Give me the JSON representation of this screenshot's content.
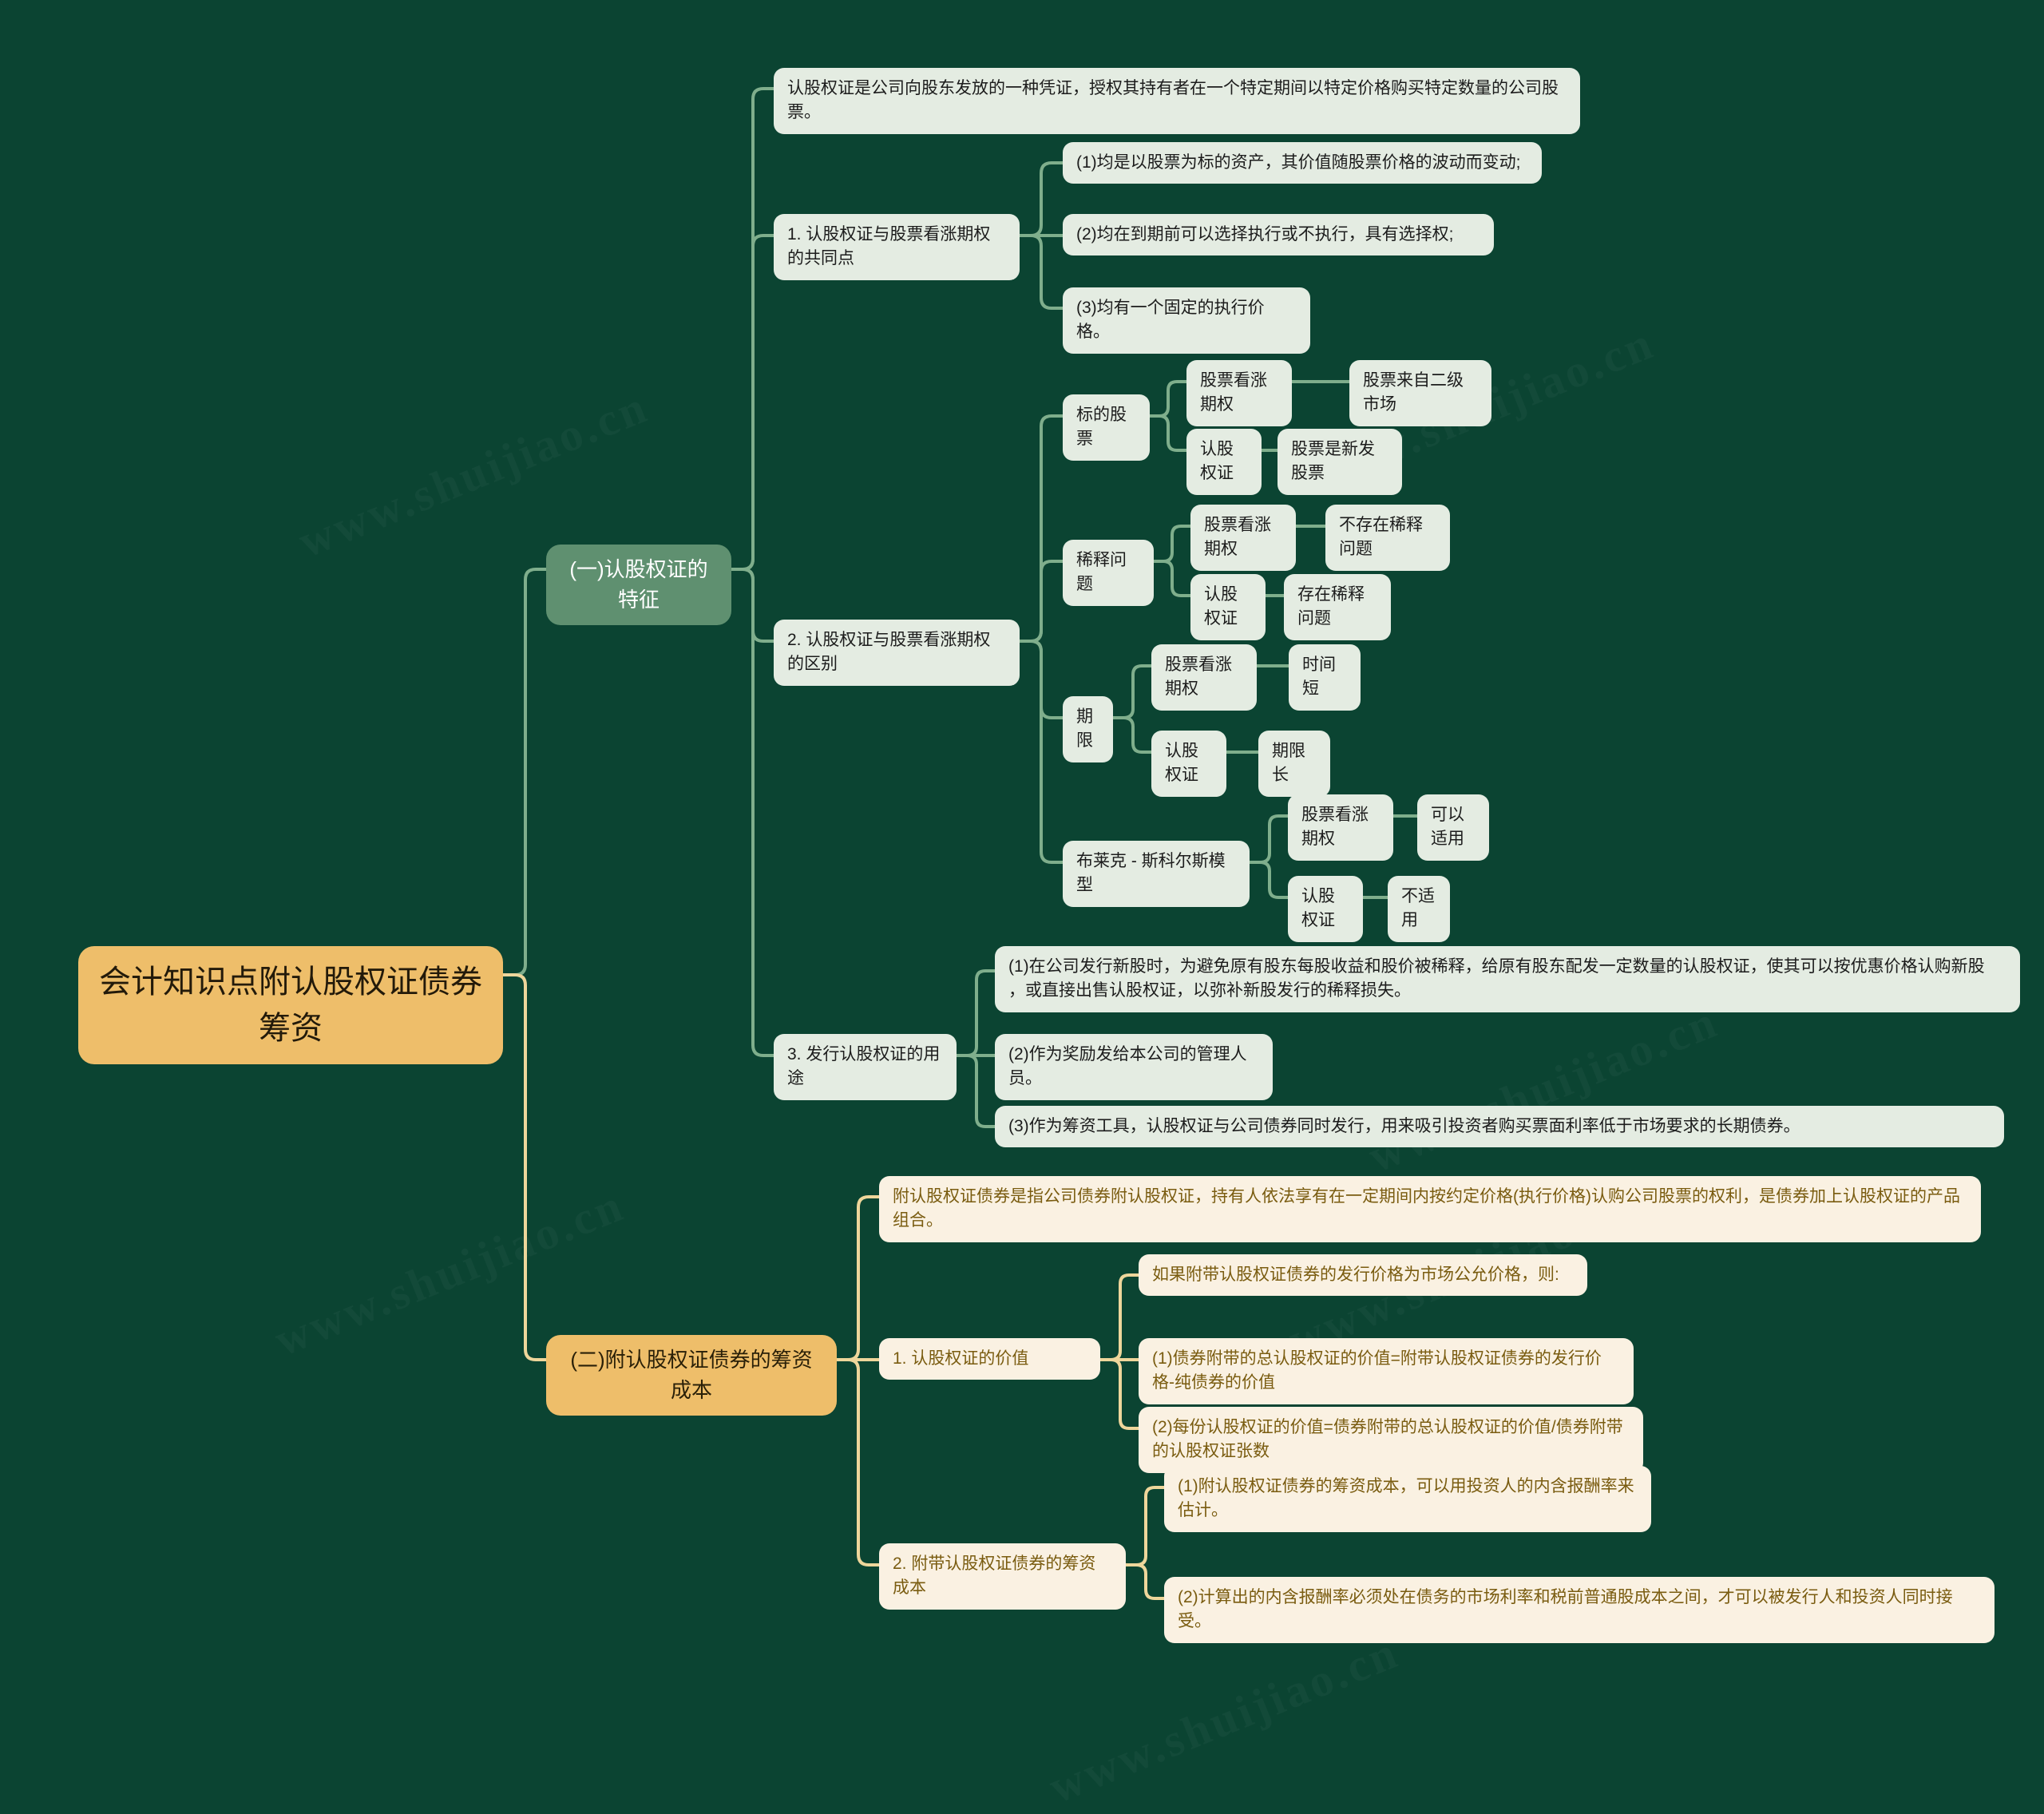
{
  "meta": {
    "background_color": "#0b4432",
    "root_color": "#eebe6a",
    "branch1_color": "#5f9070",
    "branch2_color": "#eebe6a",
    "green_node_bg": "#e4ece2",
    "cream_node_bg": "#faf1e2",
    "green_link_color": "#7fae8c",
    "orange_link_color": "#eed69b"
  },
  "watermarks": [
    "www.shuijiao.cn",
    "www.shuijiao.cn",
    "www.shuijiao.cn",
    "www.shuijiao.cn",
    "www.shuijiao.cn",
    "www.shuijiao.cn"
  ],
  "root": {
    "label": "会计知识点附认股权证债券筹资"
  },
  "branches": {
    "b1": {
      "label": "(一)认股权证的特征"
    },
    "b2": {
      "label": "(二)附认股权证债券的筹资成本"
    }
  },
  "b1_nodes": {
    "intro": "认股权证是公司向股东发放的一种凭证，授权其持有者在一个特定期间以特定价格购买特定数量的公司股票。",
    "s1": {
      "label": "1. 认股权证与股票看涨期权的共同点",
      "items": [
        "(1)均是以股票为标的资产，其价值随股票价格的波动而变动;",
        "(2)均在到期前可以选择执行或不执行，具有选择权;",
        "(3)均有一个固定的执行价格。"
      ]
    },
    "s2": {
      "label": "2. 认股权证与股票看涨期权的区别",
      "groups": [
        {
          "label": "标的股票",
          "rows": [
            {
              "key": "股票看涨期权",
              "val": "股票来自二级市场"
            },
            {
              "key": "认股权证",
              "val": "股票是新发股票"
            }
          ]
        },
        {
          "label": "稀释问题",
          "rows": [
            {
              "key": "股票看涨期权",
              "val": "不存在稀释问题"
            },
            {
              "key": "认股权证",
              "val": "存在稀释问题"
            }
          ]
        },
        {
          "label": "期限",
          "rows": [
            {
              "key": "股票看涨期权",
              "val": "时间短"
            },
            {
              "key": "认股权证",
              "val": "期限长"
            }
          ]
        },
        {
          "label": "布莱克 - 斯科尔斯模型",
          "rows": [
            {
              "key": "股票看涨期权",
              "val": "可以适用"
            },
            {
              "key": "认股权证",
              "val": "不适用"
            }
          ]
        }
      ]
    },
    "s3": {
      "label": "3. 发行认股权证的用途",
      "items": [
        "(1)在公司发行新股时，为避免原有股东每股收益和股价被稀释，给原有股东配发一定数量的认股权证，使其可以按优惠价格认购新股\n，或直接出售认股权证，以弥补新股发行的稀释损失。",
        "(2)作为奖励发给本公司的管理人员。",
        "(3)作为筹资工具，认股权证与公司债券同时发行，用来吸引投资者购买票面利率低于市场要求的长期债券。"
      ]
    }
  },
  "b2_nodes": {
    "intro": "附认股权证债券是指公司债券附认股权证，持有人依法享有在一定期间内按约定价格(执行价格)认购公司股票的权利，是债券加上认股权证的产品组合。",
    "s1": {
      "label": "1. 认股权证的价值",
      "items": [
        "如果附带认股权证债券的发行价格为市场公允价格，则:",
        "(1)债券附带的总认股权证的价值=附带认股权证债券的发行价格-纯债券的价值",
        "(2)每份认股权证的价值=债券附带的总认股权证的价值/债券附带的认股权证张数"
      ]
    },
    "s2": {
      "label": "2. 附带认股权证债券的筹资成本",
      "items": [
        "(1)附认股权证债券的筹资成本，可以用投资人的内含报酬率来估计。",
        "(2)计算出的内含报酬率必须处在债务的市场利率和税前普通股成本之间，才可以被发行人和投资人同时接受。"
      ]
    }
  }
}
